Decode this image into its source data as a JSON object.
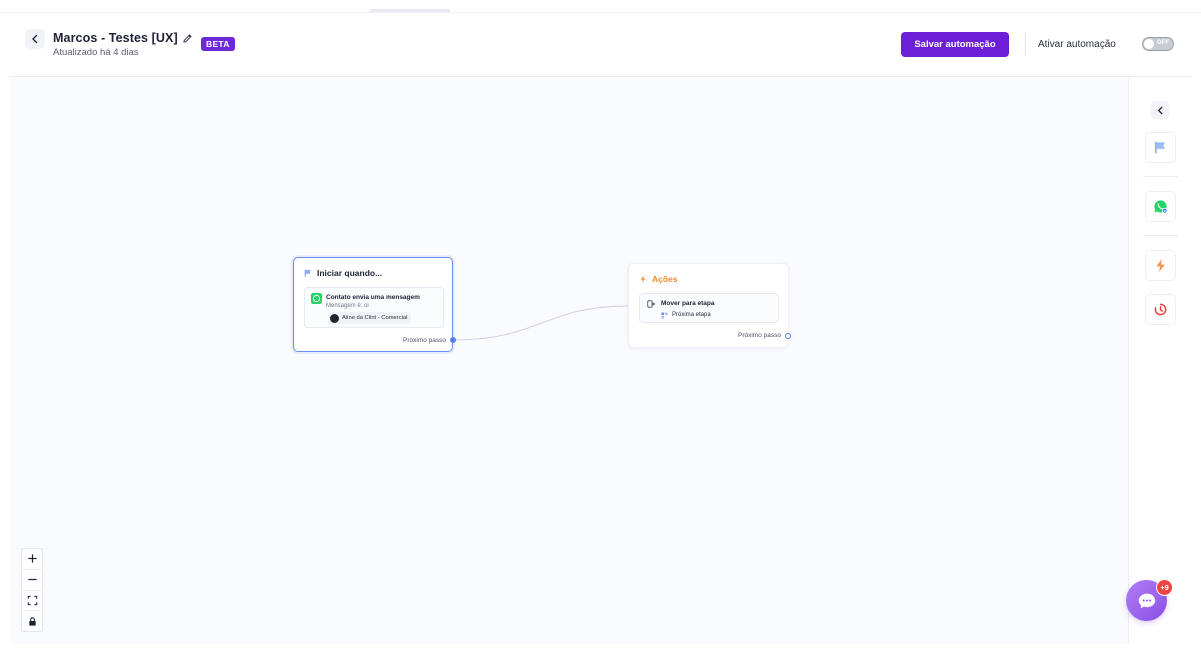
{
  "header": {
    "title": "Marcos - Testes [UX]",
    "badge": "BETA",
    "subtitle": "Atualizado há 4 dias",
    "save_label": "Salvar automação",
    "activate_label": "Ativar automação",
    "toggle_state": "OFF"
  },
  "nodes": {
    "trigger": {
      "title": "Iniciar quando...",
      "card_title": "Contato envia uma mensagem",
      "card_subtitle": "Mensagem é: oi",
      "chip_label": "Aline da Clint - Comercial",
      "next_label": "Próximo passo"
    },
    "actions": {
      "title": "Ações",
      "card_title": "Mover para etapa",
      "chip_label": "Próxima etapa",
      "next_label": "Próximo passo"
    }
  },
  "zoom_controls": [
    "plus-icon",
    "minus-icon",
    "fit-view-icon",
    "lock-icon"
  ],
  "sidebar": {
    "items": [
      "flag-icon",
      "whatsapp-icon",
      "lightning-icon",
      "timer-icon"
    ]
  },
  "chat": {
    "badge": "+9"
  },
  "colors": {
    "primary": "#6d1fd8",
    "badge": "#6d28d9",
    "node_selected_border": "#6b8ff0",
    "actions_accent": "#f08a2a",
    "whatsapp": "#25d366",
    "chat_badge": "#ef4444"
  }
}
